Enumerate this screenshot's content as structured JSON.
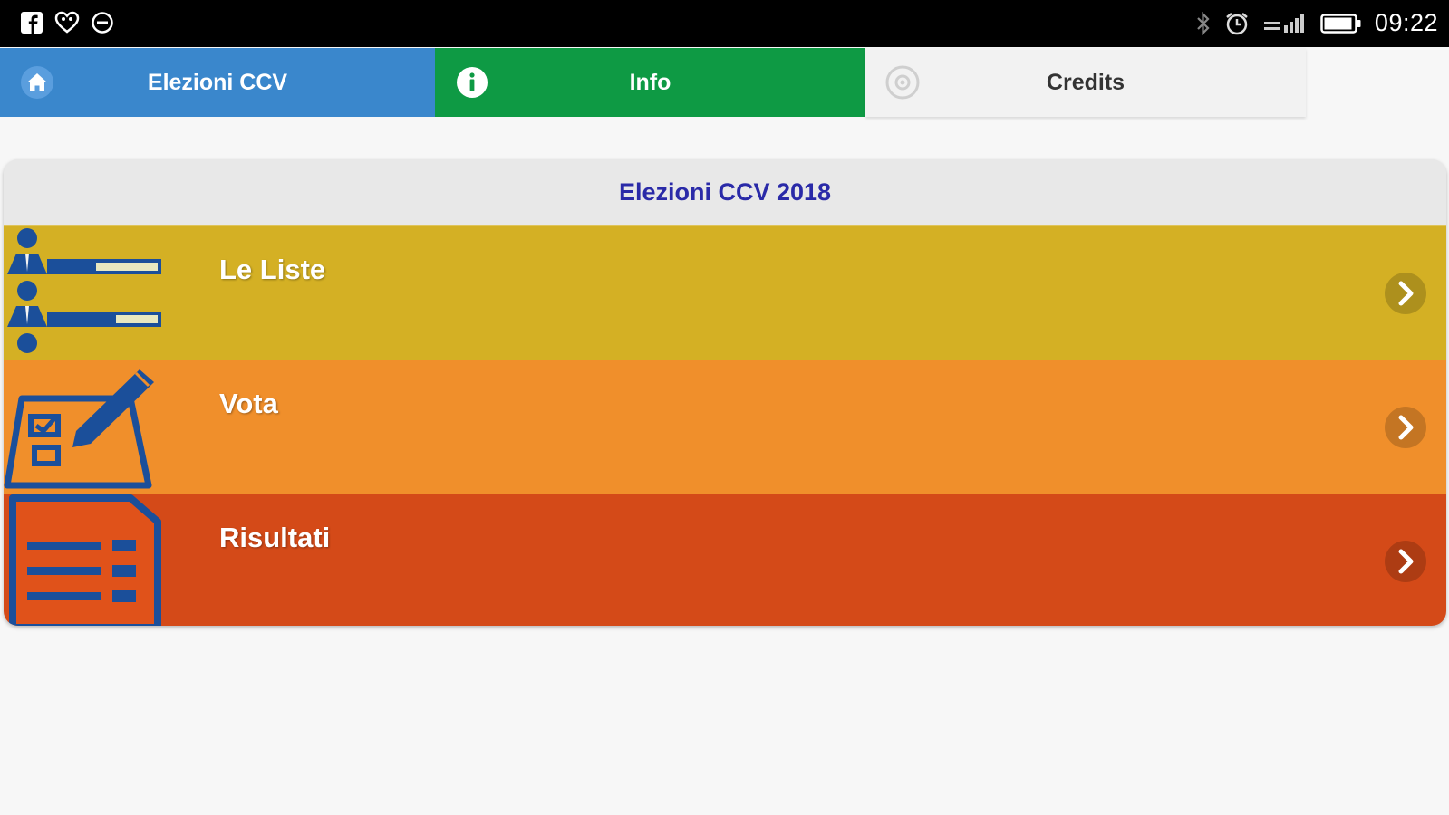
{
  "status_bar": {
    "time": "09:22",
    "left_icons": [
      "facebook-icon",
      "shield-heart-icon",
      "circle-dash-icon"
    ],
    "right_icons": [
      "bluetooth-icon",
      "alarm-icon",
      "signal-icon",
      "battery-icon"
    ]
  },
  "tabs": [
    {
      "label": "Elezioni CCV",
      "icon": "home-icon",
      "color": "#3a87cc"
    },
    {
      "label": "Info",
      "icon": "info-icon",
      "color": "#0e9a44"
    },
    {
      "label": "Credits",
      "icon": "gear-icon",
      "color": "#f2f2f2"
    }
  ],
  "panel": {
    "title": "Elezioni CCV 2018",
    "title_color": "#2a2aa8",
    "items": [
      {
        "label": "Le Liste",
        "icon": "candidates-list-icon",
        "color": "#d4b024"
      },
      {
        "label": "Vota",
        "icon": "ballot-pencil-icon",
        "color": "#f08f2b"
      },
      {
        "label": "Risultati",
        "icon": "results-document-icon",
        "color": "#d44a18"
      }
    ]
  }
}
